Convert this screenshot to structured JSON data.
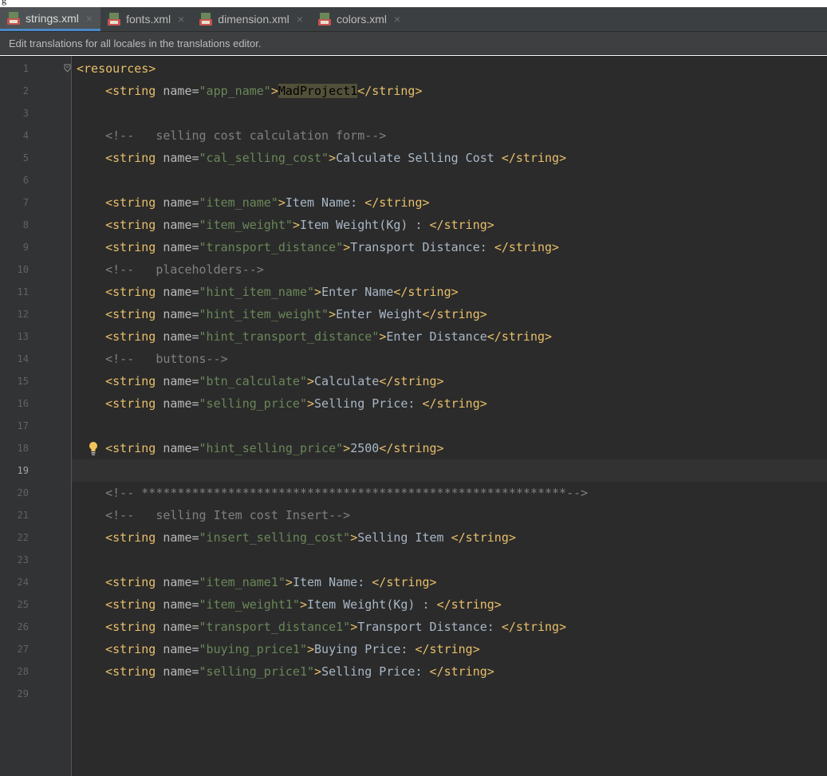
{
  "tabs": [
    {
      "label": "strings.xml",
      "active": true
    },
    {
      "label": "fonts.xml",
      "active": false
    },
    {
      "label": "dimension.xml",
      "active": false
    },
    {
      "label": "colors.xml",
      "active": false
    }
  ],
  "tab_close_glyph": "×",
  "info_bar": "Edit translations for all locales in the translations editor.",
  "current_line": 19,
  "lines": [
    {
      "n": "1",
      "segs": [
        [
          "tag",
          "<resources>"
        ]
      ]
    },
    {
      "n": "2",
      "segs": [
        [
          "tag",
          "    <string "
        ],
        [
          "attr",
          "name="
        ],
        [
          "val",
          "\"app_name\""
        ],
        [
          "tag",
          ">"
        ],
        [
          "hl",
          "MadProject1"
        ],
        [
          "tag",
          "</string>"
        ]
      ]
    },
    {
      "n": "3",
      "segs": []
    },
    {
      "n": "4",
      "segs": [
        [
          "cmt",
          "    <!--   selling cost calculation form-->"
        ]
      ]
    },
    {
      "n": "5",
      "segs": [
        [
          "tag",
          "    <string "
        ],
        [
          "attr",
          "name="
        ],
        [
          "val",
          "\"cal_selling_cost\""
        ],
        [
          "tag",
          ">"
        ],
        [
          "txt",
          "Calculate Selling Cost "
        ],
        [
          "tag",
          "</string>"
        ]
      ]
    },
    {
      "n": "6",
      "segs": []
    },
    {
      "n": "7",
      "segs": [
        [
          "tag",
          "    <string "
        ],
        [
          "attr",
          "name="
        ],
        [
          "val",
          "\"item_name\""
        ],
        [
          "tag",
          ">"
        ],
        [
          "txt",
          "Item Name: "
        ],
        [
          "tag",
          "</string>"
        ]
      ]
    },
    {
      "n": "8",
      "segs": [
        [
          "tag",
          "    <string "
        ],
        [
          "attr",
          "name="
        ],
        [
          "val",
          "\"item_weight\""
        ],
        [
          "tag",
          ">"
        ],
        [
          "txt",
          "Item Weight(Kg) : "
        ],
        [
          "tag",
          "</string>"
        ]
      ]
    },
    {
      "n": "9",
      "segs": [
        [
          "tag",
          "    <string "
        ],
        [
          "attr",
          "name="
        ],
        [
          "val",
          "\"transport_distance\""
        ],
        [
          "tag",
          ">"
        ],
        [
          "txt",
          "Transport Distance: "
        ],
        [
          "tag",
          "</string>"
        ]
      ]
    },
    {
      "n": "10",
      "segs": [
        [
          "cmt",
          "    <!--   placeholders-->"
        ]
      ]
    },
    {
      "n": "11",
      "segs": [
        [
          "tag",
          "    <string "
        ],
        [
          "attr",
          "name="
        ],
        [
          "val",
          "\"hint_item_name\""
        ],
        [
          "tag",
          ">"
        ],
        [
          "txt",
          "Enter Name"
        ],
        [
          "tag",
          "</string>"
        ]
      ]
    },
    {
      "n": "12",
      "segs": [
        [
          "tag",
          "    <string "
        ],
        [
          "attr",
          "name="
        ],
        [
          "val",
          "\"hint_item_weight\""
        ],
        [
          "tag",
          ">"
        ],
        [
          "txt",
          "Enter Weight"
        ],
        [
          "tag",
          "</string>"
        ]
      ]
    },
    {
      "n": "13",
      "segs": [
        [
          "tag",
          "    <string "
        ],
        [
          "attr",
          "name="
        ],
        [
          "val",
          "\"hint_transport_distance\""
        ],
        [
          "tag",
          ">"
        ],
        [
          "txt",
          "Enter Distance"
        ],
        [
          "tag",
          "</string>"
        ]
      ]
    },
    {
      "n": "14",
      "segs": [
        [
          "cmt",
          "    <!--   buttons-->"
        ]
      ]
    },
    {
      "n": "15",
      "segs": [
        [
          "tag",
          "    <string "
        ],
        [
          "attr",
          "name="
        ],
        [
          "val",
          "\"btn_calculate\""
        ],
        [
          "tag",
          ">"
        ],
        [
          "txt",
          "Calculate"
        ],
        [
          "tag",
          "</string>"
        ]
      ]
    },
    {
      "n": "16",
      "segs": [
        [
          "tag",
          "    <string "
        ],
        [
          "attr",
          "name="
        ],
        [
          "val",
          "\"selling_price\""
        ],
        [
          "tag",
          ">"
        ],
        [
          "txt",
          "Selling Price: "
        ],
        [
          "tag",
          "</string>"
        ]
      ]
    },
    {
      "n": "17",
      "segs": []
    },
    {
      "n": "18",
      "segs": [
        [
          "tag",
          "    <string "
        ],
        [
          "attr",
          "name="
        ],
        [
          "val",
          "\"hint_selling_price\""
        ],
        [
          "tag",
          ">"
        ],
        [
          "txt",
          "2500"
        ],
        [
          "tag",
          "</string>"
        ]
      ]
    },
    {
      "n": "19",
      "segs": []
    },
    {
      "n": "20",
      "segs": [
        [
          "cmt",
          "    <!-- ***********************************************************-->"
        ]
      ]
    },
    {
      "n": "21",
      "segs": [
        [
          "cmt",
          "    <!--   selling Item cost Insert-->"
        ]
      ]
    },
    {
      "n": "22",
      "segs": [
        [
          "tag",
          "    <string "
        ],
        [
          "attr",
          "name="
        ],
        [
          "val",
          "\"insert_selling_cost\""
        ],
        [
          "tag",
          ">"
        ],
        [
          "txt",
          "Selling Item "
        ],
        [
          "tag",
          "</string>"
        ]
      ]
    },
    {
      "n": "23",
      "segs": []
    },
    {
      "n": "24",
      "segs": [
        [
          "tag",
          "    <string "
        ],
        [
          "attr",
          "name="
        ],
        [
          "val",
          "\"item_name1\""
        ],
        [
          "tag",
          ">"
        ],
        [
          "txt",
          "Item Name: "
        ],
        [
          "tag",
          "</string>"
        ]
      ]
    },
    {
      "n": "25",
      "segs": [
        [
          "tag",
          "    <string "
        ],
        [
          "attr",
          "name="
        ],
        [
          "val",
          "\"item_weight1\""
        ],
        [
          "tag",
          ">"
        ],
        [
          "txt",
          "Item Weight(Kg) : "
        ],
        [
          "tag",
          "</string>"
        ]
      ]
    },
    {
      "n": "26",
      "segs": [
        [
          "tag",
          "    <string "
        ],
        [
          "attr",
          "name="
        ],
        [
          "val",
          "\"transport_distance1\""
        ],
        [
          "tag",
          ">"
        ],
        [
          "txt",
          "Transport Distance: "
        ],
        [
          "tag",
          "</string>"
        ]
      ]
    },
    {
      "n": "27",
      "segs": [
        [
          "tag",
          "    <string "
        ],
        [
          "attr",
          "name="
        ],
        [
          "val",
          "\"buying_price1\""
        ],
        [
          "tag",
          ">"
        ],
        [
          "txt",
          "Buying Price: "
        ],
        [
          "tag",
          "</string>"
        ]
      ]
    },
    {
      "n": "28",
      "segs": [
        [
          "tag",
          "    <string "
        ],
        [
          "attr",
          "name="
        ],
        [
          "val",
          "\"selling_price1\""
        ],
        [
          "tag",
          ">"
        ],
        [
          "txt",
          "Selling Price: "
        ],
        [
          "tag",
          "</string>"
        ]
      ]
    },
    {
      "n": "29",
      "segs": []
    }
  ],
  "icons": {
    "tab_file": "xml-file-icon",
    "bulb": "lightbulb-icon",
    "fold": "fold-marker-icon"
  },
  "colors": {
    "tag": "#e8bf6a",
    "attr": "#bababa",
    "value": "#6a8759",
    "text": "#a9b7c6",
    "comment": "#808080",
    "accent": "#4a88c7"
  }
}
